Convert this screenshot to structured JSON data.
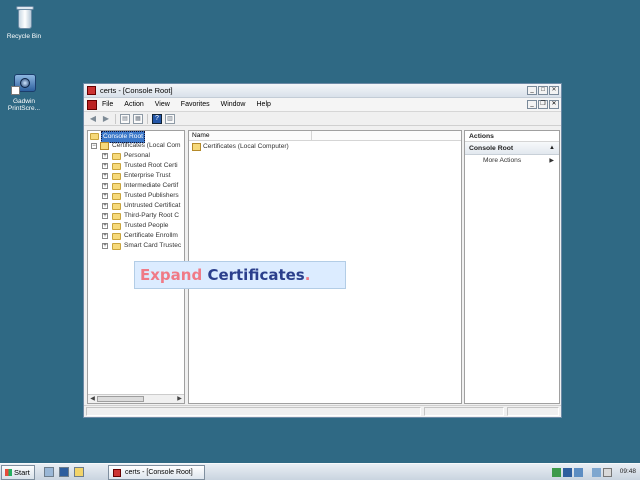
{
  "desktop": {
    "icons": [
      {
        "label": "Recycle Bin"
      },
      {
        "label_line1": "Gadwin",
        "label_line2": "PrintScre..."
      }
    ]
  },
  "window": {
    "title": "certs - [Console Root]",
    "menu": [
      "File",
      "Action",
      "View",
      "Favorites",
      "Window",
      "Help"
    ],
    "tree": {
      "root": "Console Root",
      "cert_node": "Certificates (Local Com",
      "children": [
        "Personal",
        "Trusted Root Certi",
        "Enterprise Trust",
        "Intermediate Certif",
        "Trusted Publishers",
        "Untrusted Certificat",
        "Third-Party Root C",
        "Trusted People",
        "Certificate Enrollm",
        "Smart Card Trustec"
      ]
    },
    "list": {
      "column_name": "Name",
      "items": [
        "Certificates (Local Computer)"
      ]
    },
    "actions": {
      "header": "Actions",
      "section": "Console Root",
      "more": "More Actions"
    }
  },
  "callout": {
    "word1": "Expand",
    "word2": "Certificates",
    "word3": "."
  },
  "taskbar": {
    "start": "Start",
    "task": "certs - [Console Root]",
    "clock": "09:48"
  },
  "colors": {
    "desktop": "#2f6984",
    "selection": "#3b78c9",
    "callout_bg": "#dcecff"
  }
}
